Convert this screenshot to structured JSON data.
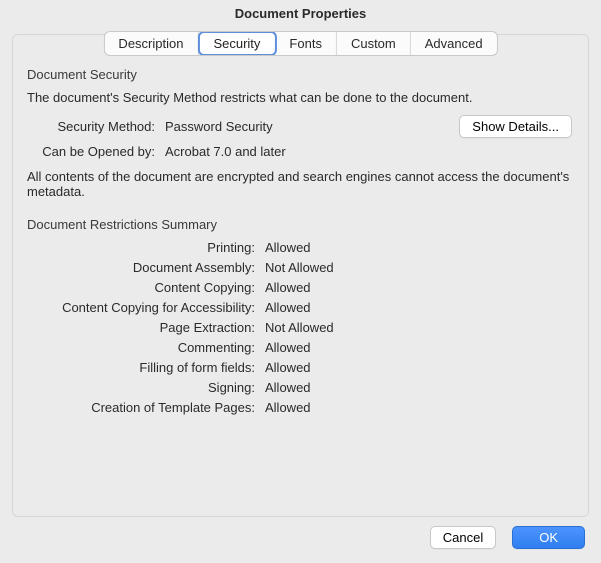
{
  "title": "Document Properties",
  "tabs": {
    "description": "Description",
    "security": "Security",
    "fonts": "Fonts",
    "custom": "Custom",
    "advanced": "Advanced"
  },
  "security": {
    "heading": "Document Security",
    "intro": "The document's Security Method restricts what can be done to the document.",
    "method_label": "Security Method:",
    "method_value": "Password Security",
    "opened_label": "Can be Opened by:",
    "opened_value": "Acrobat 7.0 and later",
    "show_details": "Show Details...",
    "encrypted_note": "All contents of the document are encrypted and search engines cannot access the document's metadata."
  },
  "restrictions": {
    "heading": "Document Restrictions Summary",
    "rows": [
      {
        "label": "Printing:",
        "value": "Allowed"
      },
      {
        "label": "Document Assembly:",
        "value": "Not Allowed"
      },
      {
        "label": "Content Copying:",
        "value": "Allowed"
      },
      {
        "label": "Content Copying for Accessibility:",
        "value": "Allowed"
      },
      {
        "label": "Page Extraction:",
        "value": "Not Allowed"
      },
      {
        "label": "Commenting:",
        "value": "Allowed"
      },
      {
        "label": "Filling of form fields:",
        "value": "Allowed"
      },
      {
        "label": "Signing:",
        "value": "Allowed"
      },
      {
        "label": "Creation of Template Pages:",
        "value": "Allowed"
      }
    ]
  },
  "footer": {
    "cancel": "Cancel",
    "ok": "OK"
  }
}
